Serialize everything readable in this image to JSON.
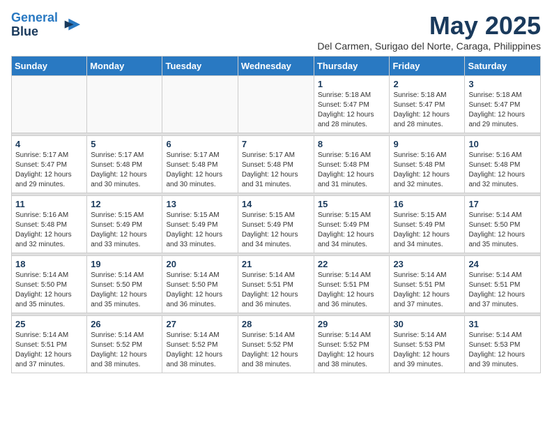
{
  "header": {
    "logo_line1": "General",
    "logo_line2": "Blue",
    "month_title": "May 2025",
    "subtitle": "Del Carmen, Surigao del Norte, Caraga, Philippines"
  },
  "weekdays": [
    "Sunday",
    "Monday",
    "Tuesday",
    "Wednesday",
    "Thursday",
    "Friday",
    "Saturday"
  ],
  "weeks": [
    [
      {
        "day": "",
        "info": ""
      },
      {
        "day": "",
        "info": ""
      },
      {
        "day": "",
        "info": ""
      },
      {
        "day": "",
        "info": ""
      },
      {
        "day": "1",
        "info": "Sunrise: 5:18 AM\nSunset: 5:47 PM\nDaylight: 12 hours\nand 28 minutes."
      },
      {
        "day": "2",
        "info": "Sunrise: 5:18 AM\nSunset: 5:47 PM\nDaylight: 12 hours\nand 28 minutes."
      },
      {
        "day": "3",
        "info": "Sunrise: 5:18 AM\nSunset: 5:47 PM\nDaylight: 12 hours\nand 29 minutes."
      }
    ],
    [
      {
        "day": "4",
        "info": "Sunrise: 5:17 AM\nSunset: 5:47 PM\nDaylight: 12 hours\nand 29 minutes."
      },
      {
        "day": "5",
        "info": "Sunrise: 5:17 AM\nSunset: 5:48 PM\nDaylight: 12 hours\nand 30 minutes."
      },
      {
        "day": "6",
        "info": "Sunrise: 5:17 AM\nSunset: 5:48 PM\nDaylight: 12 hours\nand 30 minutes."
      },
      {
        "day": "7",
        "info": "Sunrise: 5:17 AM\nSunset: 5:48 PM\nDaylight: 12 hours\nand 31 minutes."
      },
      {
        "day": "8",
        "info": "Sunrise: 5:16 AM\nSunset: 5:48 PM\nDaylight: 12 hours\nand 31 minutes."
      },
      {
        "day": "9",
        "info": "Sunrise: 5:16 AM\nSunset: 5:48 PM\nDaylight: 12 hours\nand 32 minutes."
      },
      {
        "day": "10",
        "info": "Sunrise: 5:16 AM\nSunset: 5:48 PM\nDaylight: 12 hours\nand 32 minutes."
      }
    ],
    [
      {
        "day": "11",
        "info": "Sunrise: 5:16 AM\nSunset: 5:48 PM\nDaylight: 12 hours\nand 32 minutes."
      },
      {
        "day": "12",
        "info": "Sunrise: 5:15 AM\nSunset: 5:49 PM\nDaylight: 12 hours\nand 33 minutes."
      },
      {
        "day": "13",
        "info": "Sunrise: 5:15 AM\nSunset: 5:49 PM\nDaylight: 12 hours\nand 33 minutes."
      },
      {
        "day": "14",
        "info": "Sunrise: 5:15 AM\nSunset: 5:49 PM\nDaylight: 12 hours\nand 34 minutes."
      },
      {
        "day": "15",
        "info": "Sunrise: 5:15 AM\nSunset: 5:49 PM\nDaylight: 12 hours\nand 34 minutes."
      },
      {
        "day": "16",
        "info": "Sunrise: 5:15 AM\nSunset: 5:49 PM\nDaylight: 12 hours\nand 34 minutes."
      },
      {
        "day": "17",
        "info": "Sunrise: 5:14 AM\nSunset: 5:50 PM\nDaylight: 12 hours\nand 35 minutes."
      }
    ],
    [
      {
        "day": "18",
        "info": "Sunrise: 5:14 AM\nSunset: 5:50 PM\nDaylight: 12 hours\nand 35 minutes."
      },
      {
        "day": "19",
        "info": "Sunrise: 5:14 AM\nSunset: 5:50 PM\nDaylight: 12 hours\nand 35 minutes."
      },
      {
        "day": "20",
        "info": "Sunrise: 5:14 AM\nSunset: 5:50 PM\nDaylight: 12 hours\nand 36 minutes."
      },
      {
        "day": "21",
        "info": "Sunrise: 5:14 AM\nSunset: 5:51 PM\nDaylight: 12 hours\nand 36 minutes."
      },
      {
        "day": "22",
        "info": "Sunrise: 5:14 AM\nSunset: 5:51 PM\nDaylight: 12 hours\nand 36 minutes."
      },
      {
        "day": "23",
        "info": "Sunrise: 5:14 AM\nSunset: 5:51 PM\nDaylight: 12 hours\nand 37 minutes."
      },
      {
        "day": "24",
        "info": "Sunrise: 5:14 AM\nSunset: 5:51 PM\nDaylight: 12 hours\nand 37 minutes."
      }
    ],
    [
      {
        "day": "25",
        "info": "Sunrise: 5:14 AM\nSunset: 5:51 PM\nDaylight: 12 hours\nand 37 minutes."
      },
      {
        "day": "26",
        "info": "Sunrise: 5:14 AM\nSunset: 5:52 PM\nDaylight: 12 hours\nand 38 minutes."
      },
      {
        "day": "27",
        "info": "Sunrise: 5:14 AM\nSunset: 5:52 PM\nDaylight: 12 hours\nand 38 minutes."
      },
      {
        "day": "28",
        "info": "Sunrise: 5:14 AM\nSunset: 5:52 PM\nDaylight: 12 hours\nand 38 minutes."
      },
      {
        "day": "29",
        "info": "Sunrise: 5:14 AM\nSunset: 5:52 PM\nDaylight: 12 hours\nand 38 minutes."
      },
      {
        "day": "30",
        "info": "Sunrise: 5:14 AM\nSunset: 5:53 PM\nDaylight: 12 hours\nand 39 minutes."
      },
      {
        "day": "31",
        "info": "Sunrise: 5:14 AM\nSunset: 5:53 PM\nDaylight: 12 hours\nand 39 minutes."
      }
    ]
  ]
}
